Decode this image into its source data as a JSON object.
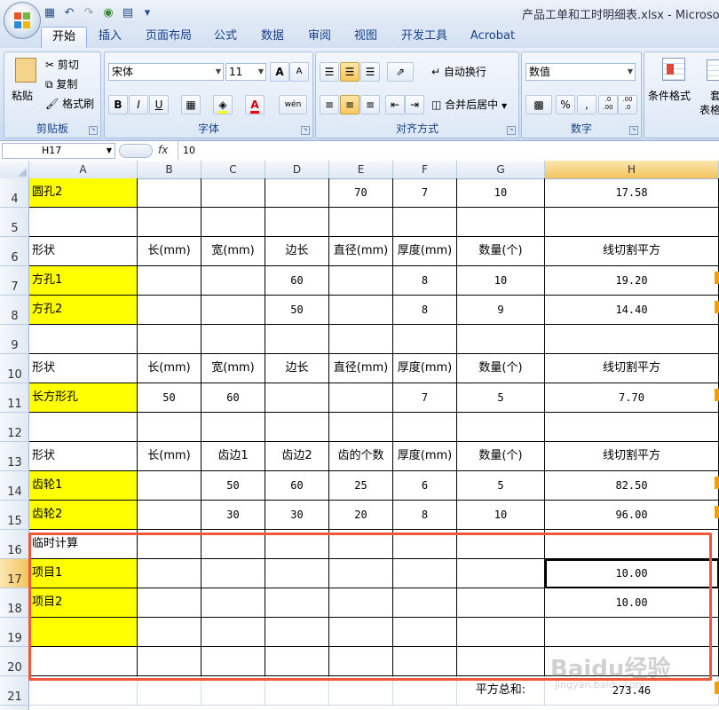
{
  "window": {
    "title": "产品工单和工时明细表.xlsx - Microso"
  },
  "quick_access": {
    "icons": [
      "save-icon",
      "undo-icon",
      "redo-icon",
      "refresh-icon",
      "format-icon",
      "dropdown-icon"
    ]
  },
  "tabs": [
    "开始",
    "插入",
    "页面布局",
    "公式",
    "数据",
    "审阅",
    "视图",
    "开发工具",
    "Acrobat"
  ],
  "ribbon": {
    "clipboard": {
      "paste": "粘贴",
      "cut": "剪切",
      "copy": "复制",
      "format_painter": "格式刷",
      "label": "剪贴板"
    },
    "font": {
      "name": "宋体",
      "size": "11",
      "label": "字体",
      "bold": "B",
      "italic": "I",
      "underline": "U",
      "grow": "A",
      "shrink": "A",
      "phonetic": "wén"
    },
    "alignment": {
      "wrap": "自动换行",
      "merge": "合并后居中",
      "label": "对齐方式"
    },
    "number": {
      "format": "数值",
      "percent": "%",
      "comma": ",",
      "label": "数字",
      "inc": ".0 .00",
      "dec": ".00 .0"
    },
    "styles": {
      "conditional": "条件格式",
      "table": "套",
      "table2": "表格"
    }
  },
  "formula_bar": {
    "name_box": "H17",
    "fx": "fx",
    "value": "10"
  },
  "columns": [
    "A",
    "B",
    "C",
    "D",
    "E",
    "F",
    "G",
    "H"
  ],
  "rows": [
    {
      "num": "4",
      "cells": [
        "圆孔2",
        "",
        "",
        "",
        "70",
        "7",
        "10",
        "17.58"
      ],
      "yellow": true
    },
    {
      "num": "5",
      "cells": [
        "",
        "",
        "",
        "",
        "",
        "",
        "",
        ""
      ],
      "yellow": false
    },
    {
      "num": "6",
      "cells": [
        "形状",
        "长(mm)",
        "宽(mm)",
        "边长",
        "直径(mm)",
        "厚度(mm)",
        "数量(个)",
        "线切割平方"
      ],
      "yellow": false
    },
    {
      "num": "7",
      "cells": [
        "方孔1",
        "",
        "",
        "60",
        "",
        "8",
        "10",
        "19.20"
      ],
      "yellow": true
    },
    {
      "num": "8",
      "cells": [
        "方孔2",
        "",
        "",
        "50",
        "",
        "8",
        "9",
        "14.40"
      ],
      "yellow": true
    },
    {
      "num": "9",
      "cells": [
        "",
        "",
        "",
        "",
        "",
        "",
        "",
        ""
      ],
      "yellow": false
    },
    {
      "num": "10",
      "cells": [
        "形状",
        "长(mm)",
        "宽(mm)",
        "边长",
        "直径(mm)",
        "厚度(mm)",
        "数量(个)",
        "线切割平方"
      ],
      "yellow": false
    },
    {
      "num": "11",
      "cells": [
        "长方形孔",
        "50",
        "60",
        "",
        "",
        "7",
        "5",
        "7.70"
      ],
      "yellow": true
    },
    {
      "num": "12",
      "cells": [
        "",
        "",
        "",
        "",
        "",
        "",
        "",
        ""
      ],
      "yellow": false
    },
    {
      "num": "13",
      "cells": [
        "形状",
        "长(mm)",
        "齿边1",
        "齿边2",
        "齿的个数",
        "厚度(mm)",
        "数量(个)",
        "线切割平方"
      ],
      "yellow": false
    },
    {
      "num": "14",
      "cells": [
        "齿轮1",
        "",
        "50",
        "60",
        "25",
        "6",
        "5",
        "82.50"
      ],
      "yellow": true
    },
    {
      "num": "15",
      "cells": [
        "齿轮2",
        "",
        "30",
        "30",
        "20",
        "8",
        "10",
        "96.00"
      ],
      "yellow": true
    },
    {
      "num": "16",
      "cells": [
        "临时计算",
        "",
        "",
        "",
        "",
        "",
        "",
        ""
      ],
      "yellow": false
    },
    {
      "num": "17",
      "cells": [
        "项目1",
        "",
        "",
        "",
        "",
        "",
        "",
        "10.00"
      ],
      "yellow": true
    },
    {
      "num": "18",
      "cells": [
        "项目2",
        "",
        "",
        "",
        "",
        "",
        "",
        "10.00"
      ],
      "yellow": true
    },
    {
      "num": "19",
      "cells": [
        "",
        "",
        "",
        "",
        "",
        "",
        "",
        ""
      ],
      "yellow": true
    },
    {
      "num": "20",
      "cells": [
        "",
        "",
        "",
        "",
        "",
        "",
        "",
        ""
      ],
      "yellow": false
    },
    {
      "num": "21",
      "cells": [
        "",
        "",
        "",
        "",
        "",
        "",
        "平方总和:",
        "273.46"
      ],
      "yellow": false
    }
  ],
  "watermark": {
    "main": "Baidu经验",
    "sub": "jingyan.baidu.com"
  }
}
